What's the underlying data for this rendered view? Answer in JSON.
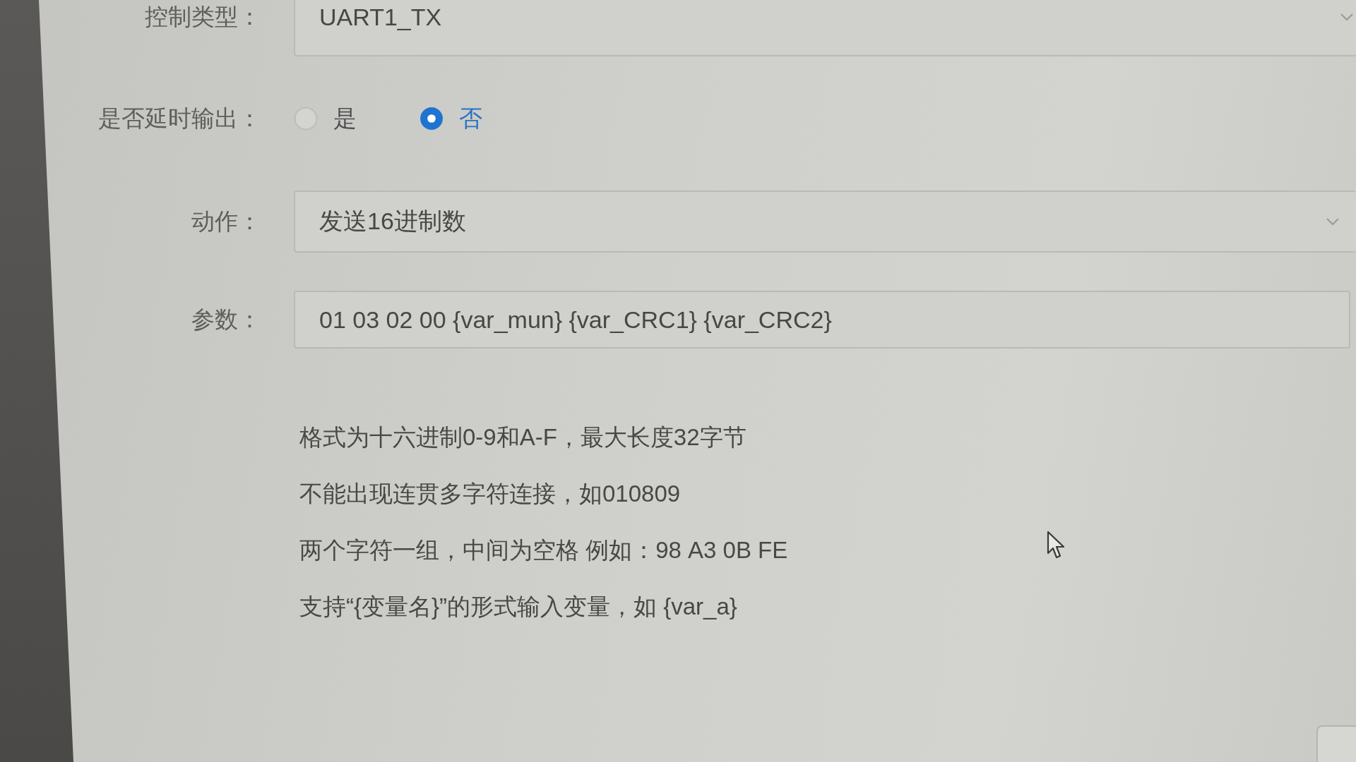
{
  "form": {
    "fields": [
      {
        "kind": "select",
        "label": "控制类型：",
        "value": "UART1_TX"
      },
      {
        "kind": "radio",
        "label": "是否延时输出：",
        "options": [
          {
            "label": "是",
            "selected": false
          },
          {
            "label": "否",
            "selected": true
          }
        ]
      },
      {
        "kind": "select",
        "label": "动作：",
        "value": "发送16进制数"
      },
      {
        "kind": "input",
        "label": "参数：",
        "value": "01 03 02 00 {var_mun} {var_CRC1} {var_CRC2}"
      }
    ],
    "hints": [
      "格式为十六进制0-9和A-F，最大长度32字节",
      "不能出现连贯多字符连接，如010809",
      "两个字符一组，中间为空格 例如：98 A3 0B FE",
      "支持“{变量名}”的形式输入变量，如 {var_a}"
    ]
  }
}
